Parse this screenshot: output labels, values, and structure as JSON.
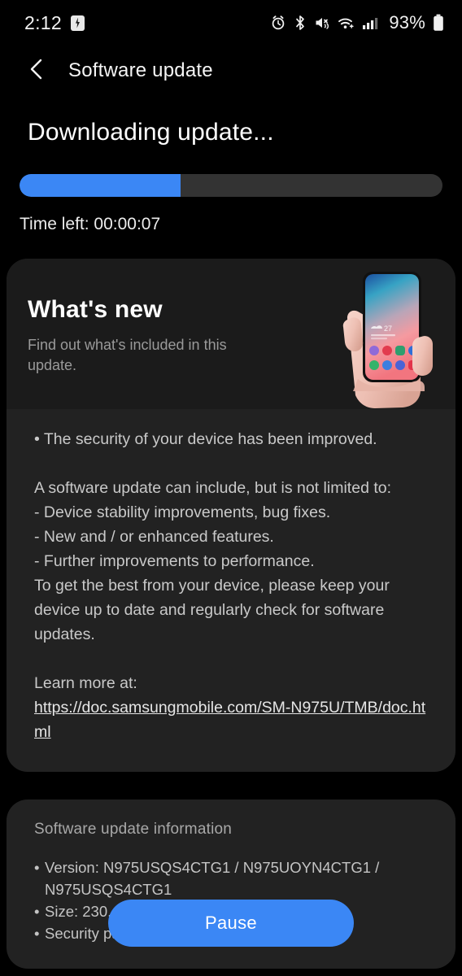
{
  "status_bar": {
    "time": "2:12",
    "battery_percent": "93%",
    "icons": [
      "notification-icon",
      "alarm-icon",
      "bluetooth-icon",
      "mute-vibrate-icon",
      "wifi-icon",
      "signal-icon",
      "battery-icon"
    ]
  },
  "header": {
    "title": "Software update",
    "back_icon": "chevron-left-icon"
  },
  "progress": {
    "title": "Downloading update...",
    "percent": 38,
    "time_left": "Time left: 00:00:07",
    "fill_color": "#3b87f5",
    "track_color": "#333333"
  },
  "whats_new": {
    "title": "What's new",
    "subtitle": "Find out what's included in this update.",
    "image": "hand-holding-phone-illustration"
  },
  "release_notes": {
    "bullet": "• The security of your device has been improved.",
    "intro": "A software update can include, but is not limited to:",
    "items": [
      " - Device stability improvements, bug fixes.",
      " - New and / or enhanced features.",
      " - Further improvements to performance."
    ],
    "outro": "To get the best from your device, please keep your device up to date and regularly check for software updates.",
    "learn_more_label": "Learn more at:",
    "learn_more_url": "https://doc.samsungmobile.com/SM-N975U/TMB/doc.html"
  },
  "update_info": {
    "title": "Software update information",
    "rows": [
      "Version: N975USQS4CTG1 / N975UOYN4CTG1 / N975USQS4CTG1",
      "Size: 230.46 MB",
      "Security patch level: August 1, 2020"
    ],
    "bullet_char": "•"
  },
  "footer": {
    "pause_label": "Pause"
  }
}
